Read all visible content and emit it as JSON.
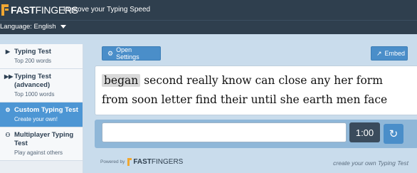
{
  "header": {
    "logo_bold": "FAST",
    "logo_light": "FINGERS",
    "tagline": "Improve your Typing Speed"
  },
  "language": {
    "label": "Language: English"
  },
  "sidebar": {
    "items": [
      {
        "title": "Typing Test",
        "sub": "Top 200 words",
        "icon": "play-icon"
      },
      {
        "title": "Typing Test (advanced)",
        "sub": "Top 1000 words",
        "icon": "fast-forward-icon"
      },
      {
        "title": "Custom Typing Test",
        "sub": "Create your own!",
        "icon": "gears-icon"
      },
      {
        "title": "Multiplayer Typing Test",
        "sub": "Play against others",
        "icon": "users-icon"
      }
    ]
  },
  "toolbar": {
    "open_settings": "Open Settings",
    "embed": "Embed"
  },
  "test": {
    "current_word": "began",
    "line1_rest": "second really know can close any her form",
    "line2": "from soon letter find their until she earth men face",
    "timer": "1:00",
    "input_value": ""
  },
  "footer": {
    "powered": "Powered by",
    "logo_bold": "FAST",
    "logo_light": "FINGERS",
    "tagline": "create your own Typing Test"
  }
}
